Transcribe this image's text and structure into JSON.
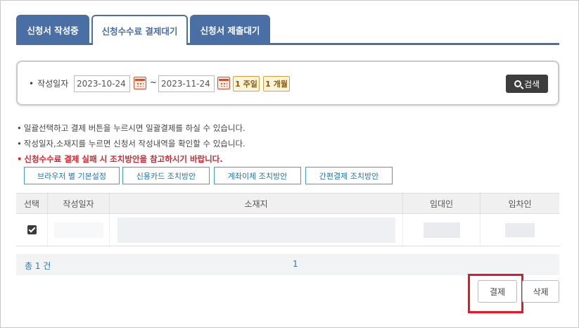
{
  "tabs": [
    {
      "label": "신청서 작성중"
    },
    {
      "label": "신청수수료 결제대기"
    },
    {
      "label": "신청서 제출대기"
    }
  ],
  "search": {
    "date_label": "작성일자",
    "start_date": "2023-10-24",
    "separator": "~",
    "end_date": "2023-11-24",
    "period_week": "1 주일",
    "period_month": "1 개월",
    "search_label": "검색"
  },
  "notes": [
    "일괄선택하고 결제 버튼을 누르시면 일괄결제를 하실 수 있습니다.",
    "작성일자,소재지를 누르면 신청서 작성내역을 확인할 수 있습니다.",
    "신청수수료 결제 실패 시 조치방안을 참고하시기 바랍니다."
  ],
  "guide_buttons": [
    {
      "label": "브라우저 별 기본설정"
    },
    {
      "label": "신용카드 조치방안"
    },
    {
      "label": "계좌이체 조치방안"
    },
    {
      "label": "간편결제 조치방안"
    }
  ],
  "table": {
    "columns": [
      "선택",
      "작성일자",
      "소재지",
      "임대인",
      "임차인"
    ],
    "rows": [
      {
        "checked": true
      }
    ]
  },
  "summary": {
    "total": "총 1 건",
    "page": "1"
  },
  "actions": {
    "pay_label": "결제",
    "delete_label": "삭제"
  },
  "colors": {
    "tab_blue": "#4a6fa5",
    "notice_red": "#d0262d",
    "highlight_red": "#e01a2a"
  }
}
